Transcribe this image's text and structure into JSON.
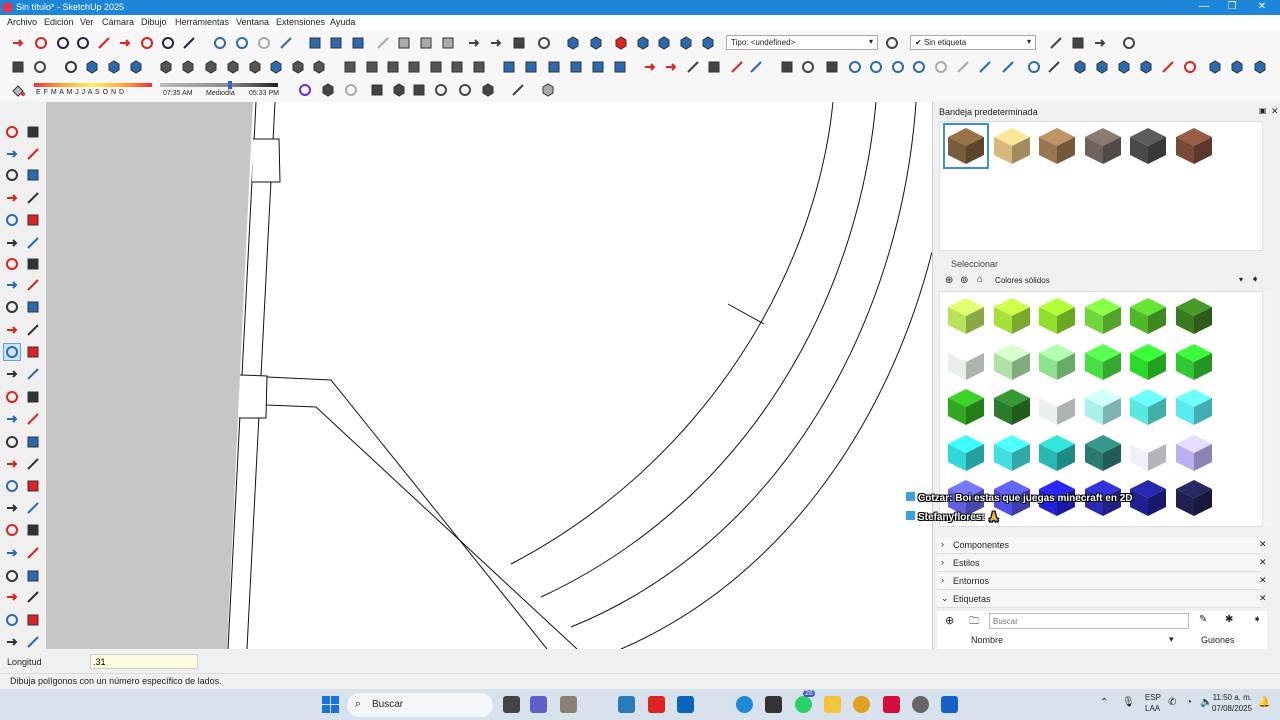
{
  "window": {
    "title": "Sin título* - SketchUp 2025",
    "controls": [
      "—",
      "❐",
      "✕"
    ]
  },
  "menu": [
    "Archivo",
    "Edición",
    "Ver",
    "Cámara",
    "Dibujo",
    "Herramientas",
    "Ventana",
    "Extensiones",
    "Ayuda"
  ],
  "toolbar": {
    "tag_type_label": "Tipo: <undefined>",
    "tag_select_label": "Sin etiqueta",
    "shadow_months": "E F M A M J J A S O N D",
    "shadow_time_start": "07:35 AM",
    "shadow_time_mid": "Mediodía",
    "shadow_time_end": "05:33 PM"
  },
  "tray": {
    "title": "Bandeja predeterminada",
    "select_label": "Seleccionar",
    "library": "Colores sólidos",
    "recent_colors": [
      "#7a5c3a",
      "#d8b87a",
      "#9a7550",
      "#6e625a",
      "#4a4a4a",
      "#7a4a38"
    ],
    "grid_colors": [
      [
        "#b6e35a",
        "#a6e03a",
        "#8ee02a",
        "#6ed83a",
        "#4fb82a",
        "#3a7a20"
      ],
      [
        "#e8efe8",
        "#aee2a6",
        "#8ee28e",
        "#48e040",
        "#2ed82a",
        "#30c830"
      ],
      [
        "#30a820",
        "#2a7a28",
        "#e8f0f0",
        "#a8f0ea",
        "#58e8e0",
        "#58e8f0"
      ],
      [
        "#30d8d8",
        "#40e0e0",
        "#28b8b0",
        "#2a7a70",
        "#f0f0f8",
        "#b8b0f0"
      ],
      [
        "#6060e0",
        "#5050e8",
        "#2020d8",
        "#2a2ab0",
        "#202090",
        "#202050"
      ]
    ],
    "sections": [
      "Componentes",
      "Estilos",
      "Entornos",
      "Etiquetas"
    ],
    "tag_search_placeholder": "Buscar",
    "tag_col_name": "Nombre",
    "tag_col_dash": "Guiones"
  },
  "chat": {
    "line1": "Cotzar: Boi estas que juegas minecraft en 2D",
    "line2": "Stefanyflores: 🙏"
  },
  "status": {
    "measure_label": "Longitud",
    "measure_value": ".31",
    "hint": "Dibuja polígonos con un número específico de lados."
  },
  "taskbar": {
    "search": "Buscar",
    "lang": "ESP",
    "lang2": "LAA",
    "time": "11:50 a. m.",
    "date": "07/08/2025",
    "badge": "26"
  }
}
